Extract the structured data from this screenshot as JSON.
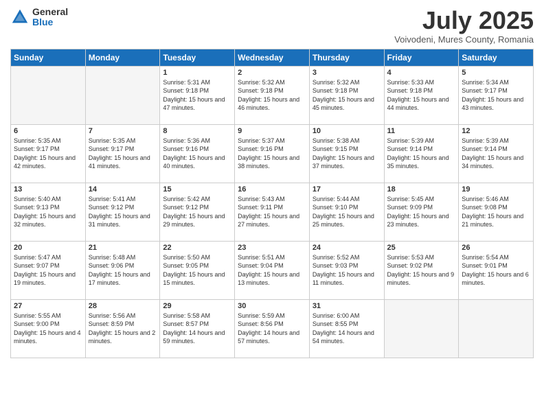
{
  "header": {
    "logo_general": "General",
    "logo_blue": "Blue",
    "month_title": "July 2025",
    "subtitle": "Voivodeni, Mures County, Romania"
  },
  "weekdays": [
    "Sunday",
    "Monday",
    "Tuesday",
    "Wednesday",
    "Thursday",
    "Friday",
    "Saturday"
  ],
  "weeks": [
    [
      {
        "day": "",
        "info": ""
      },
      {
        "day": "",
        "info": ""
      },
      {
        "day": "1",
        "info": "Sunrise: 5:31 AM\nSunset: 9:18 PM\nDaylight: 15 hours and 47 minutes."
      },
      {
        "day": "2",
        "info": "Sunrise: 5:32 AM\nSunset: 9:18 PM\nDaylight: 15 hours and 46 minutes."
      },
      {
        "day": "3",
        "info": "Sunrise: 5:32 AM\nSunset: 9:18 PM\nDaylight: 15 hours and 45 minutes."
      },
      {
        "day": "4",
        "info": "Sunrise: 5:33 AM\nSunset: 9:18 PM\nDaylight: 15 hours and 44 minutes."
      },
      {
        "day": "5",
        "info": "Sunrise: 5:34 AM\nSunset: 9:17 PM\nDaylight: 15 hours and 43 minutes."
      }
    ],
    [
      {
        "day": "6",
        "info": "Sunrise: 5:35 AM\nSunset: 9:17 PM\nDaylight: 15 hours and 42 minutes."
      },
      {
        "day": "7",
        "info": "Sunrise: 5:35 AM\nSunset: 9:17 PM\nDaylight: 15 hours and 41 minutes."
      },
      {
        "day": "8",
        "info": "Sunrise: 5:36 AM\nSunset: 9:16 PM\nDaylight: 15 hours and 40 minutes."
      },
      {
        "day": "9",
        "info": "Sunrise: 5:37 AM\nSunset: 9:16 PM\nDaylight: 15 hours and 38 minutes."
      },
      {
        "day": "10",
        "info": "Sunrise: 5:38 AM\nSunset: 9:15 PM\nDaylight: 15 hours and 37 minutes."
      },
      {
        "day": "11",
        "info": "Sunrise: 5:39 AM\nSunset: 9:14 PM\nDaylight: 15 hours and 35 minutes."
      },
      {
        "day": "12",
        "info": "Sunrise: 5:39 AM\nSunset: 9:14 PM\nDaylight: 15 hours and 34 minutes."
      }
    ],
    [
      {
        "day": "13",
        "info": "Sunrise: 5:40 AM\nSunset: 9:13 PM\nDaylight: 15 hours and 32 minutes."
      },
      {
        "day": "14",
        "info": "Sunrise: 5:41 AM\nSunset: 9:12 PM\nDaylight: 15 hours and 31 minutes."
      },
      {
        "day": "15",
        "info": "Sunrise: 5:42 AM\nSunset: 9:12 PM\nDaylight: 15 hours and 29 minutes."
      },
      {
        "day": "16",
        "info": "Sunrise: 5:43 AM\nSunset: 9:11 PM\nDaylight: 15 hours and 27 minutes."
      },
      {
        "day": "17",
        "info": "Sunrise: 5:44 AM\nSunset: 9:10 PM\nDaylight: 15 hours and 25 minutes."
      },
      {
        "day": "18",
        "info": "Sunrise: 5:45 AM\nSunset: 9:09 PM\nDaylight: 15 hours and 23 minutes."
      },
      {
        "day": "19",
        "info": "Sunrise: 5:46 AM\nSunset: 9:08 PM\nDaylight: 15 hours and 21 minutes."
      }
    ],
    [
      {
        "day": "20",
        "info": "Sunrise: 5:47 AM\nSunset: 9:07 PM\nDaylight: 15 hours and 19 minutes."
      },
      {
        "day": "21",
        "info": "Sunrise: 5:48 AM\nSunset: 9:06 PM\nDaylight: 15 hours and 17 minutes."
      },
      {
        "day": "22",
        "info": "Sunrise: 5:50 AM\nSunset: 9:05 PM\nDaylight: 15 hours and 15 minutes."
      },
      {
        "day": "23",
        "info": "Sunrise: 5:51 AM\nSunset: 9:04 PM\nDaylight: 15 hours and 13 minutes."
      },
      {
        "day": "24",
        "info": "Sunrise: 5:52 AM\nSunset: 9:03 PM\nDaylight: 15 hours and 11 minutes."
      },
      {
        "day": "25",
        "info": "Sunrise: 5:53 AM\nSunset: 9:02 PM\nDaylight: 15 hours and 9 minutes."
      },
      {
        "day": "26",
        "info": "Sunrise: 5:54 AM\nSunset: 9:01 PM\nDaylight: 15 hours and 6 minutes."
      }
    ],
    [
      {
        "day": "27",
        "info": "Sunrise: 5:55 AM\nSunset: 9:00 PM\nDaylight: 15 hours and 4 minutes."
      },
      {
        "day": "28",
        "info": "Sunrise: 5:56 AM\nSunset: 8:59 PM\nDaylight: 15 hours and 2 minutes."
      },
      {
        "day": "29",
        "info": "Sunrise: 5:58 AM\nSunset: 8:57 PM\nDaylight: 14 hours and 59 minutes."
      },
      {
        "day": "30",
        "info": "Sunrise: 5:59 AM\nSunset: 8:56 PM\nDaylight: 14 hours and 57 minutes."
      },
      {
        "day": "31",
        "info": "Sunrise: 6:00 AM\nSunset: 8:55 PM\nDaylight: 14 hours and 54 minutes."
      },
      {
        "day": "",
        "info": ""
      },
      {
        "day": "",
        "info": ""
      }
    ]
  ]
}
